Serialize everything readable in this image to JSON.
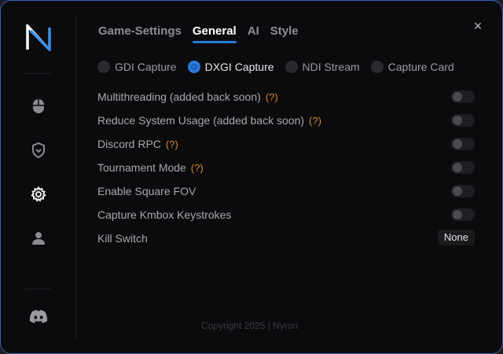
{
  "sidebar": {
    "logo_icon": "nyron-n-logo",
    "items": [
      {
        "id": "mouse",
        "icon": "mouse-icon"
      },
      {
        "id": "shield",
        "icon": "shield-icon"
      },
      {
        "id": "settings",
        "icon": "gear-icon",
        "active": true
      },
      {
        "id": "account",
        "icon": "user-icon"
      }
    ],
    "bottom_icon": "discord-icon"
  },
  "tabs": [
    {
      "label": "Game-Settings"
    },
    {
      "label": "General",
      "active": true
    },
    {
      "label": "AI"
    },
    {
      "label": "Style"
    }
  ],
  "close_label": "×",
  "capture_modes": [
    {
      "label": "GDI Capture",
      "selected": false
    },
    {
      "label": "DXGI Capture",
      "selected": true
    },
    {
      "label": "NDI Stream",
      "selected": false
    },
    {
      "label": "Capture Card",
      "selected": false
    }
  ],
  "settings": [
    {
      "label": "Multithreading (added back soon)",
      "help": "(?)",
      "enabled": false
    },
    {
      "label": "Reduce System Usage (added back soon)",
      "help": "(?)",
      "enabled": false
    },
    {
      "label": "Discord RPC",
      "help": "(?)",
      "enabled": false
    },
    {
      "label": "Tournament Mode",
      "help": "(?)",
      "enabled": false
    },
    {
      "label": "Enable Square FOV",
      "enabled": false
    },
    {
      "label": "Capture Kmbox Keystrokes",
      "enabled": false
    }
  ],
  "kill_switch": {
    "label": "Kill Switch",
    "value": "None"
  },
  "footer": "Copyright 2025 | Nyron",
  "colors": {
    "accent": "#2a7ad8",
    "help": "#d98a2a",
    "border": "#2e66b8"
  }
}
